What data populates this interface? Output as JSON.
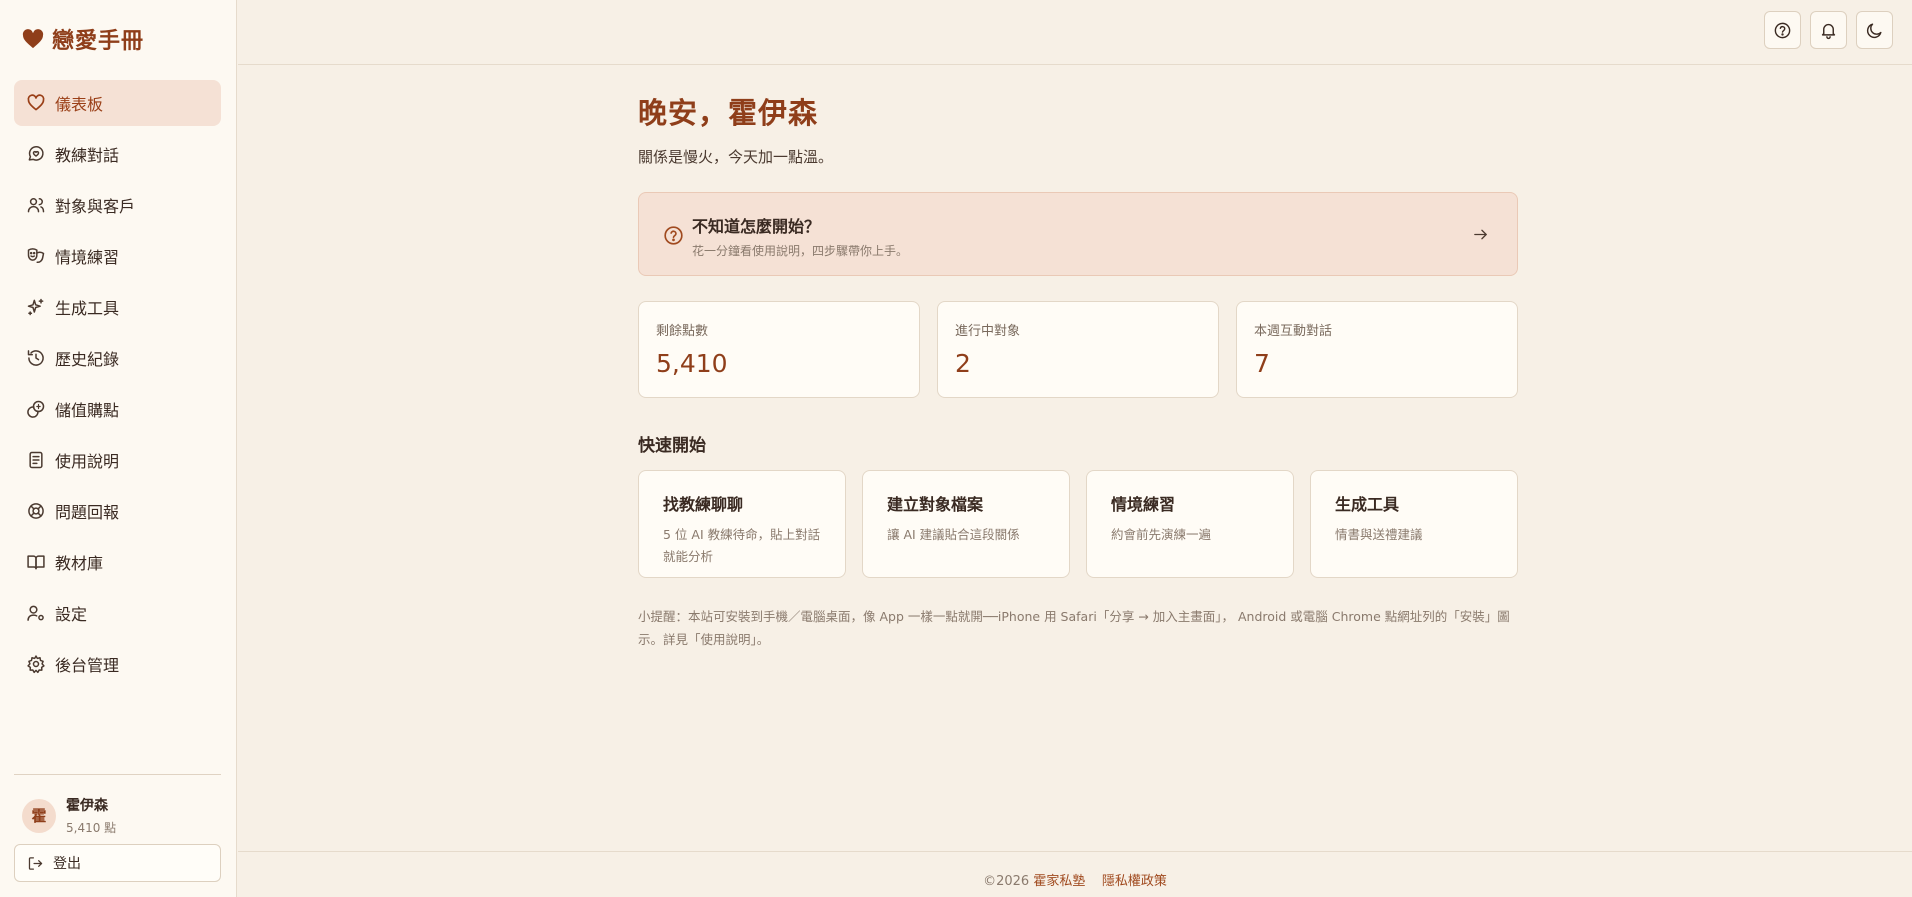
{
  "app": {
    "brand": "戀愛手冊",
    "brand_icon": "heart-icon"
  },
  "sidebar": {
    "items": [
      {
        "label": "儀表板",
        "icon": "heart-icon",
        "active": true
      },
      {
        "label": "教練對話",
        "icon": "chat-heart-icon"
      },
      {
        "label": "對象與客戶",
        "icon": "users-icon"
      },
      {
        "label": "情境練習",
        "icon": "drama-masks-icon"
      },
      {
        "label": "生成工具",
        "icon": "sparkles-icon"
      },
      {
        "label": "歷史紀錄",
        "icon": "history-icon"
      },
      {
        "label": "儲值購點",
        "icon": "coins-icon"
      },
      {
        "label": "使用說明",
        "icon": "document-icon"
      },
      {
        "label": "問題回報",
        "icon": "lifebuoy-icon"
      },
      {
        "label": "教材庫",
        "icon": "book-icon"
      },
      {
        "label": "設定",
        "icon": "user-settings-icon"
      },
      {
        "label": "後台管理",
        "icon": "gear-icon"
      }
    ],
    "user": {
      "avatar": "霍",
      "name": "霍伊森",
      "points": "5,410 點"
    },
    "logout_label": "登出"
  },
  "topbar": {
    "buttons": [
      "help-icon",
      "bell-icon",
      "moon-icon"
    ]
  },
  "main": {
    "greeting": "晚安，霍伊森",
    "subtitle": "關係是慢火，今天加一點溫。",
    "help_card": {
      "title": "不知道怎麼開始？",
      "desc": "花一分鐘看使用說明，四步驟帶你上手。"
    },
    "stats": [
      {
        "label": "剩餘點數",
        "value": "5,410"
      },
      {
        "label": "進行中對象",
        "value": "2"
      },
      {
        "label": "本週互動對話",
        "value": "7"
      }
    ],
    "quick_title": "快速開始",
    "quick": [
      {
        "title": "找教練聊聊",
        "desc": "5 位 AI 教練待命，貼上對話就能分析"
      },
      {
        "title": "建立對象檔案",
        "desc": "讓 AI 建議貼合這段關係"
      },
      {
        "title": "情境練習",
        "desc": "約會前先演練一遍"
      },
      {
        "title": "生成工具",
        "desc": "情書與送禮建議"
      }
    ],
    "tip": "小提醒：本站可安裝到手機／電腦桌面，像 App 一樣一點就開──iPhone 用 Safari「分享 → 加入主畫面」， Android 或電腦 Chrome 點網址列的「安裝」圖示。詳見「使用說明」。"
  },
  "footer": {
    "copyright": "©2026",
    "school": "霍家私塾",
    "privacy": "隱私權政策"
  },
  "colors": {
    "accent": "#8f3e1a",
    "background": "#f7f0e6",
    "sidebar_bg": "#fdf9f2",
    "active_bg": "#f5e1d5"
  }
}
